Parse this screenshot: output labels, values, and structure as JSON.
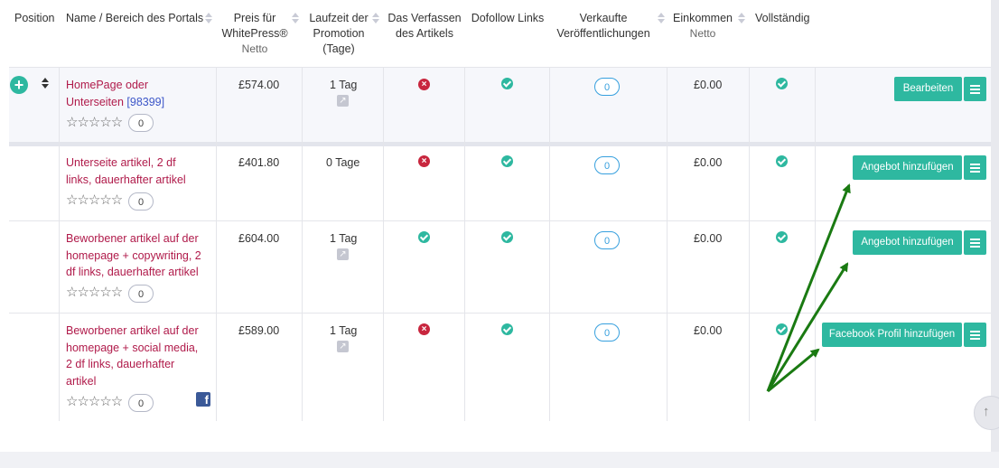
{
  "columns": {
    "position": "Position",
    "name": "Name / Bereich des Portals",
    "price_l1": "Preis für",
    "price_l2": "WhitePress®",
    "price_sub": "Netto",
    "duration_l1": "Laufzeit der",
    "duration_l2": "Promotion",
    "duration_l3": "(Tage)",
    "writing_l1": "Das Verfassen",
    "writing_l2": "des Artikels",
    "dofollow": "Dofollow Links",
    "sold_l1": "Verkaufte",
    "sold_l2": "Veröffentlichungen",
    "income": "Einkommen",
    "income_sub": "Netto",
    "complete": "Vollständig"
  },
  "rows": [
    {
      "name_lines": [
        "HomePage oder",
        "Unterseiten "
      ],
      "id": "[98399]",
      "rating_count": "0",
      "price": "£574.00",
      "duration": "1 Tag",
      "writing": "no",
      "dofollow": "yes",
      "sold": "0",
      "income": "£0.00",
      "complete": "yes",
      "action": "Bearbeiten"
    },
    {
      "name_lines": [
        "Unterseite artikel, 2 df",
        "links, dauerhafter artikel"
      ],
      "rating_count": "0",
      "price": "£401.80",
      "duration": "0 Tage",
      "writing": "no",
      "dofollow": "yes",
      "sold": "0",
      "income": "£0.00",
      "complete": "yes",
      "action": "Angebot hinzufügen"
    },
    {
      "name_lines": [
        "Beworbener artikel auf der",
        "homepage + copywriting, 2",
        "df links, dauerhafter artikel"
      ],
      "rating_count": "0",
      "price": "£604.00",
      "duration": "1 Tag",
      "writing": "yes",
      "dofollow": "yes",
      "sold": "0",
      "income": "£0.00",
      "complete": "yes",
      "action": "Angebot hinzufügen"
    },
    {
      "name_lines": [
        "Beworbener artikel auf der",
        "homepage + social media,",
        "2 df links, dauerhafter",
        "artikel"
      ],
      "rating_count": "0",
      "price": "£589.00",
      "duration": "1 Tag",
      "writing": "no",
      "dofollow": "yes",
      "sold": "0",
      "income": "£0.00",
      "complete": "yes",
      "action": "Facebook Profil hinzufügen"
    }
  ],
  "stars": "☆☆☆☆☆",
  "colors": {
    "accent": "#2eb8a0",
    "name_link": "#b01a4a",
    "id_link": "#3c56c8",
    "error": "#c8263e",
    "annotation_arrow": "#1a7a12"
  }
}
